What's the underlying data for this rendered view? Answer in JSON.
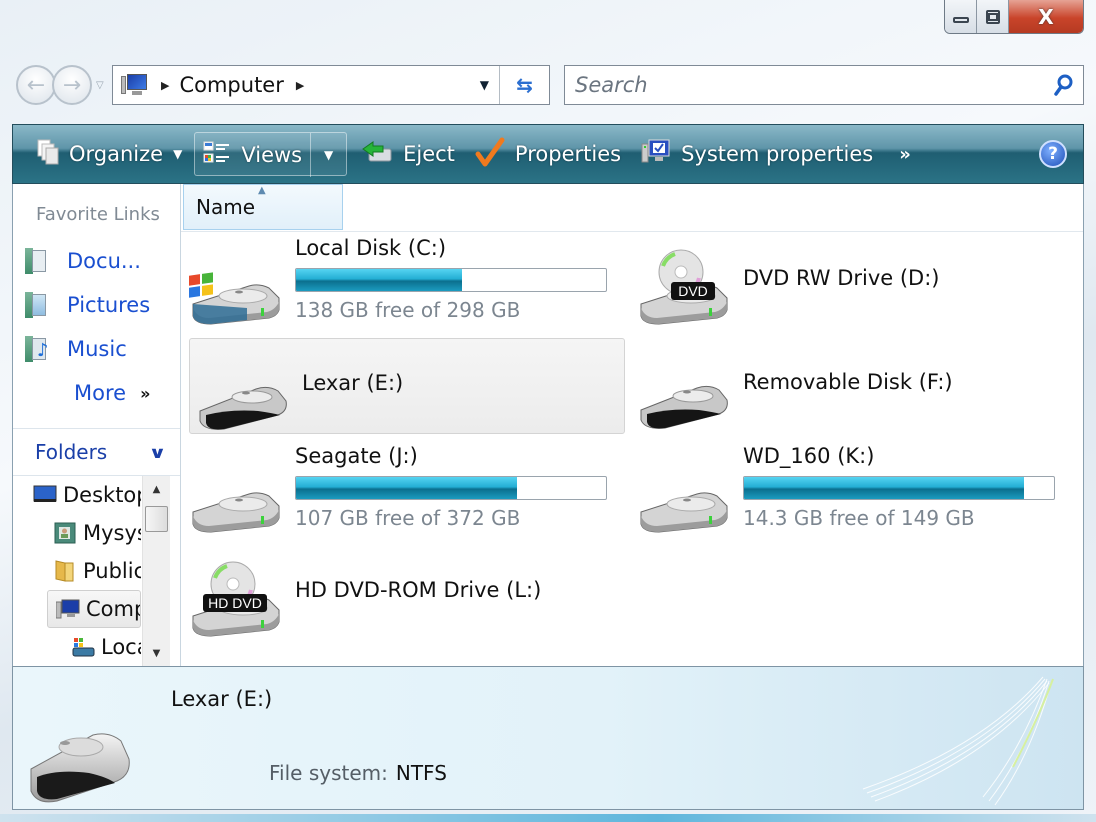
{
  "window": {
    "caption_buttons": [
      {
        "name": "minimize",
        "icon": "minimize-icon"
      },
      {
        "name": "maximize",
        "icon": "maximize-icon"
      },
      {
        "name": "close",
        "icon": "close-icon",
        "glyph": "X"
      }
    ]
  },
  "navigation": {
    "back_icon": "back-arrow-icon",
    "forward_icon": "forward-arrow-icon",
    "recent_icon": "chevron-down-icon",
    "address": {
      "icon": "computer-icon",
      "crumb_sep": "▶",
      "crumbs": [
        "Computer"
      ],
      "trailing_sep": "▶",
      "dropdown_glyph": "▼",
      "refresh_glyph": "⇆"
    },
    "search": {
      "placeholder": "Search",
      "icon": "search-icon"
    }
  },
  "toolbar": {
    "organize": {
      "label": "Organize",
      "icon": "organize-icon",
      "caret": "▼"
    },
    "views": {
      "label": "Views",
      "icon": "views-icon",
      "caret": "▼"
    },
    "eject": {
      "label": "Eject",
      "icon": "eject-icon"
    },
    "properties": {
      "label": "Properties",
      "icon": "checkmark-icon"
    },
    "system_properties": {
      "label": "System properties",
      "icon": "system-properties-icon"
    },
    "overflow": "»",
    "help": "?"
  },
  "nav_pane": {
    "favorites_title": "Favorite Links",
    "favorites": [
      {
        "label": "Docu...",
        "icon": "documents-icon"
      },
      {
        "label": "Pictures",
        "icon": "pictures-icon"
      },
      {
        "label": "Music",
        "icon": "music-icon"
      }
    ],
    "more": {
      "label": "More",
      "glyph": "»"
    },
    "folders": {
      "label": "Folders",
      "glyph": "⌄"
    },
    "tree": [
      {
        "label": "Desktop",
        "icon": "desktop-icon",
        "level": 0
      },
      {
        "label": "Mysystem",
        "icon": "user-folder-icon",
        "level": 1
      },
      {
        "label": "Public",
        "icon": "folder-icon",
        "level": 1
      },
      {
        "label": "Computer",
        "icon": "computer-icon",
        "level": 1,
        "selected": true
      },
      {
        "label": "Local Disk (C:)",
        "icon": "windows-drive-icon",
        "level": 2
      }
    ],
    "scroll": {
      "up": "▲",
      "down": "▼"
    }
  },
  "content": {
    "column_header": {
      "label": "Name",
      "sort_glyph": "▲"
    },
    "drives": [
      {
        "name": "Local Disk (C:)",
        "type": "system-hdd",
        "free": "138 GB free of 298 GB",
        "used_fraction": 0.537,
        "selected": false
      },
      {
        "name": "DVD RW Drive (D:)",
        "type": "dvd",
        "badge": "DVD",
        "selected": false
      },
      {
        "name": "Lexar (E:)",
        "type": "removable",
        "selected": true
      },
      {
        "name": "Removable Disk (F:)",
        "type": "removable",
        "selected": false
      },
      {
        "name": "Seagate (J:)",
        "type": "hdd",
        "free": "107 GB free of 372 GB",
        "used_fraction": 0.712,
        "selected": false
      },
      {
        "name": "WD_160 (K:)",
        "type": "hdd",
        "free": "14.3 GB free of 149 GB",
        "used_fraction": 0.904,
        "selected": false
      },
      {
        "name": "HD DVD-ROM Drive (L:)",
        "type": "dvd",
        "badge": "HD DVD",
        "selected": false
      }
    ]
  },
  "details": {
    "title": "Lexar (E:)",
    "file_system_label": "File system:",
    "file_system_value": "NTFS"
  },
  "colors": {
    "toolbar_top": "#8ab8c8",
    "toolbar_bottom": "#1f5e72",
    "link_blue": "#1a4fd0",
    "bar_fill": "#24aed4",
    "close_red": "#c9442a"
  }
}
